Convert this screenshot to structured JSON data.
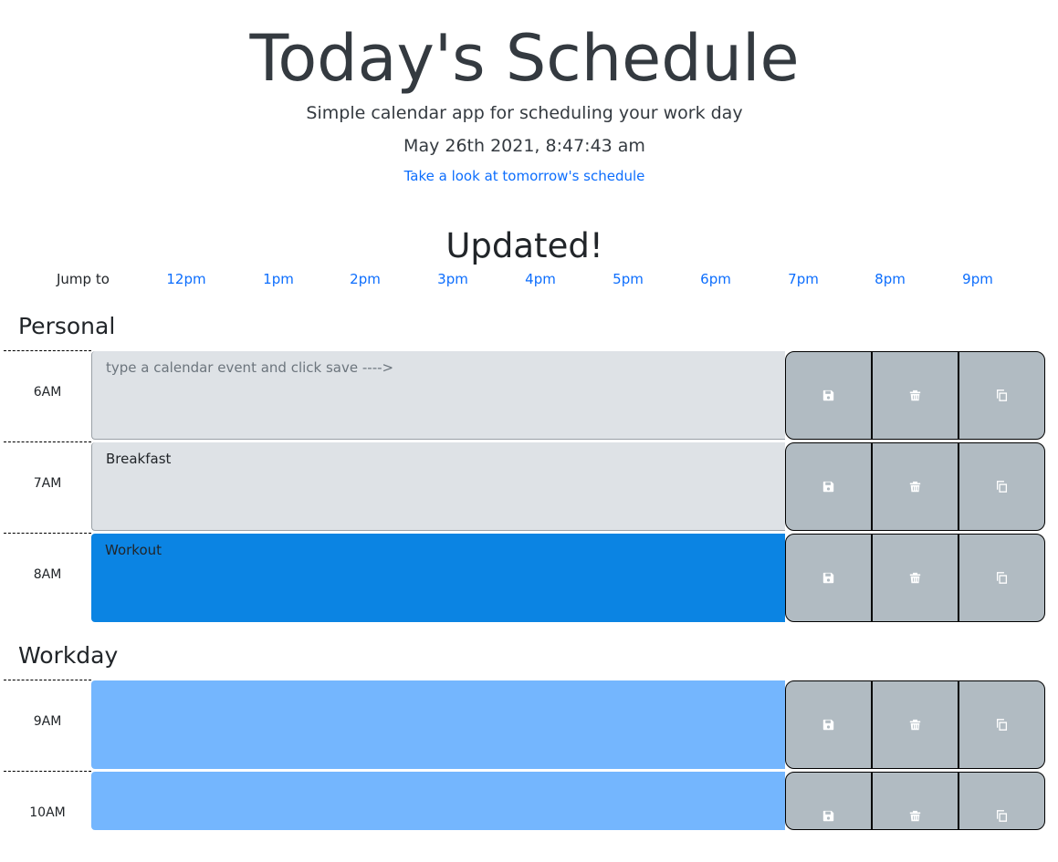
{
  "header": {
    "title": "Today's Schedule",
    "subtitle": "Simple calendar app for scheduling your work day",
    "datetime": "May 26th 2021, 8:47:43 am",
    "tomorrow_link": "Take a look at tomorrow's schedule"
  },
  "status": {
    "message": "Updated!"
  },
  "jump": {
    "label": "Jump to",
    "links": [
      "12pm",
      "1pm",
      "2pm",
      "3pm",
      "4pm",
      "5pm",
      "6pm",
      "7pm",
      "8pm",
      "9pm"
    ]
  },
  "sections": [
    {
      "title": "Personal",
      "rows": [
        {
          "hour": "6AM",
          "text": "",
          "placeholder": "type a calendar event and click save ---->",
          "state": "past"
        },
        {
          "hour": "7AM",
          "text": "Breakfast",
          "placeholder": "",
          "state": "past"
        },
        {
          "hour": "8AM",
          "text": "Workout",
          "placeholder": "",
          "state": "present"
        }
      ]
    },
    {
      "title": "Workday",
      "rows": [
        {
          "hour": "9AM",
          "text": "",
          "placeholder": "",
          "state": "future"
        },
        {
          "hour": "10AM",
          "text": "",
          "placeholder": "",
          "state": "future"
        }
      ]
    }
  ],
  "buttons": {
    "save_icon": "floppy-disk-icon",
    "delete_icon": "trash-icon",
    "copy_icon": "copy-icon"
  },
  "colors": {
    "link": "#0d6efd",
    "past": "#dee2e6",
    "present": "#0b84e3",
    "future": "#74b6fe",
    "button": "#b1bbc2"
  }
}
